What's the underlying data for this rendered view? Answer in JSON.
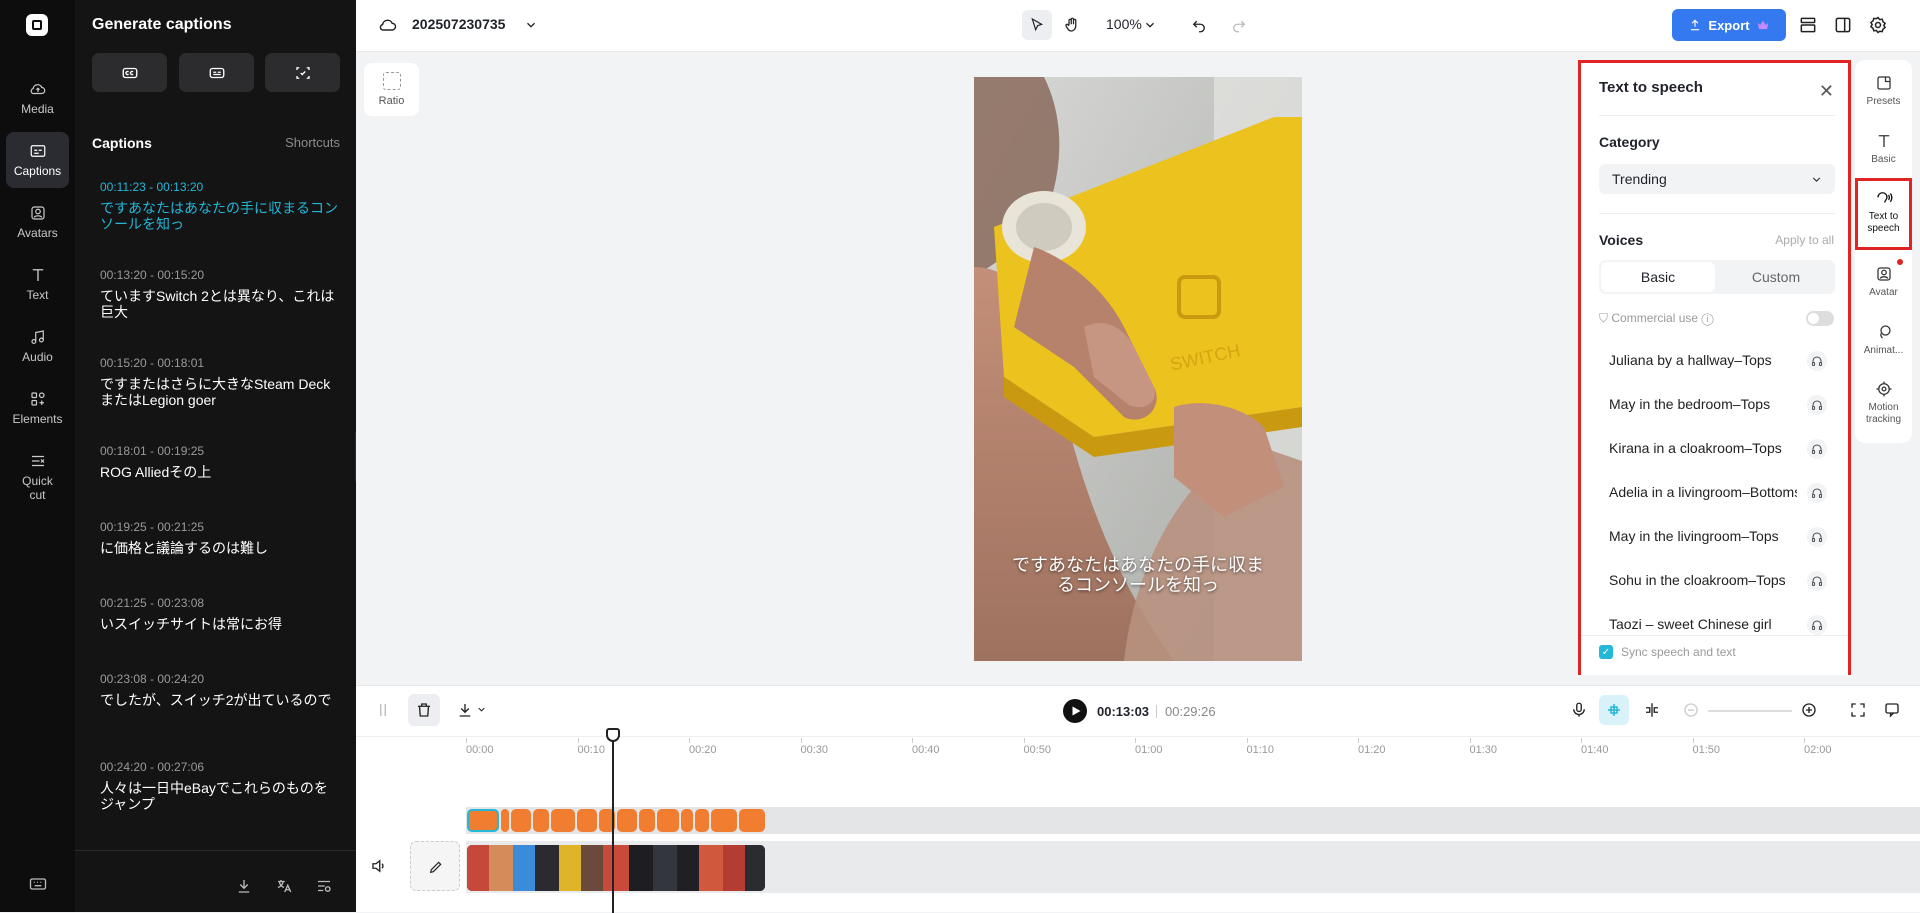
{
  "nav": {
    "items": [
      {
        "label": "Media",
        "icon": "cloud-icon"
      },
      {
        "label": "Captions",
        "icon": "captions-icon",
        "active": true
      },
      {
        "label": "Avatars",
        "icon": "avatar-icon"
      },
      {
        "label": "Text",
        "icon": "text-icon"
      },
      {
        "label": "Audio",
        "icon": "music-icon"
      },
      {
        "label": "Elements",
        "icon": "elements-icon"
      },
      {
        "label": "Quick cut",
        "icon": "quickcut-icon"
      }
    ]
  },
  "captions": {
    "title": "Generate captions",
    "section": "Captions",
    "shortcuts": "Shortcuts",
    "items": [
      {
        "time": "00:11:23 - 00:13:20",
        "text": "ですあなたはあなたの手に収まるコンソールを知っ",
        "active": true
      },
      {
        "time": "00:13:20 - 00:15:20",
        "text": "ていますSwitch 2とは異なり、これは巨大"
      },
      {
        "time": "00:15:20 - 00:18:01",
        "text": "ですまたはさらに大きなSteam DeckまたはLegion goer"
      },
      {
        "time": "00:18:01 - 00:19:25",
        "text": "ROG Alliedその上"
      },
      {
        "time": "00:19:25 - 00:21:25",
        "text": "に価格と議論するのは難し"
      },
      {
        "time": "00:21:25 - 00:23:08",
        "text": "いスイッチサイトは常にお得"
      },
      {
        "time": "00:23:08 - 00:24:20",
        "text": "でしたが、スイッチ2が出ているので"
      },
      {
        "time": "00:24:20 - 00:27:06",
        "text": "人々は一日中eBayでこれらのものをジャンプ"
      }
    ]
  },
  "topbar": {
    "project": "202507230735",
    "zoom": "100%",
    "export": "Export"
  },
  "canvas": {
    "ratio": "Ratio",
    "subtitle_line1": "ですあなたはあなたの手に収ま",
    "subtitle_line2": "るコンソールを知っ",
    "switch_text": "SWITCH"
  },
  "tts": {
    "title": "Text to speech",
    "category_label": "Category",
    "category_value": "Trending",
    "voices_label": "Voices",
    "apply_all": "Apply to all",
    "tab_basic": "Basic",
    "tab_custom": "Custom",
    "commercial": "Commercial use",
    "voices": [
      "Juliana by a hallway–Tops",
      "May in the bedroom–Tops",
      "Kirana in a cloakroom–Tops",
      "Adelia in a livingroom–Bottoms",
      "May in the livingroom–Tops",
      "Sohu in the cloakroom–Tops",
      "Taozi – sweet Chinese girl"
    ],
    "sync": "Sync speech and text"
  },
  "rail": {
    "items": [
      {
        "label": "Presets",
        "icon": "presets-icon"
      },
      {
        "label": "Basic",
        "icon": "text-t-icon"
      },
      {
        "label": "Text to speech",
        "icon": "speech-icon",
        "active": true
      },
      {
        "label": "Avatar",
        "icon": "avatar-icon"
      },
      {
        "label": "Animat...",
        "icon": "animation-icon"
      },
      {
        "label": "Motion tracking",
        "icon": "target-icon"
      }
    ]
  },
  "timeline": {
    "current": "00:13:03",
    "duration": "00:29:26",
    "ticks": [
      "00:00",
      "00:10",
      "00:20",
      "00:30",
      "00:40",
      "00:50",
      "01:00",
      "01:10",
      "01:20",
      "01:30",
      "01:40",
      "01:50",
      "02:00"
    ]
  },
  "colors": {
    "accent": "#23b7d8",
    "export": "#3479ef",
    "highlight": "#e02424",
    "clip": "#f07d30"
  }
}
